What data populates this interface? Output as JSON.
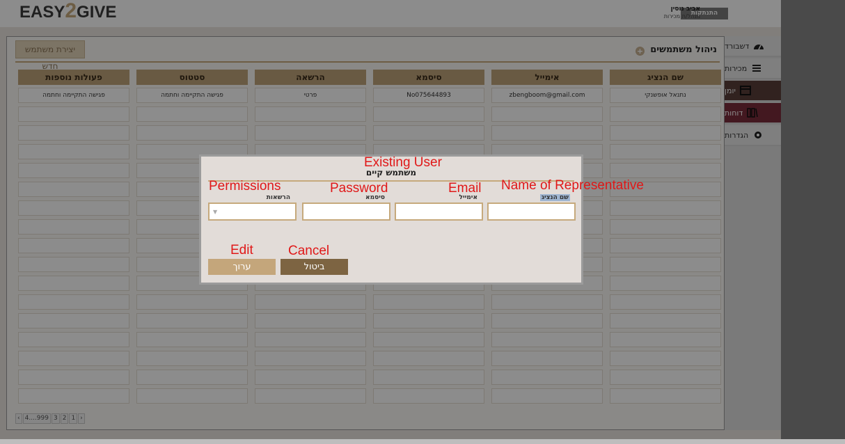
{
  "header": {
    "logo_part1": "EASY",
    "logo_part2": "2",
    "logo_part3": "GIVE",
    "logout_label": "התנתקות",
    "user_name": "אביב נוסין",
    "user_role": "מנהל/ת מכירות"
  },
  "sidebar": {
    "items": [
      {
        "label": "דשבורד",
        "icon": "dashboard-icon"
      },
      {
        "label": "מכירות",
        "icon": "sales-icon"
      },
      {
        "label": "יומן",
        "icon": "calendar-icon"
      },
      {
        "label": "דוחות",
        "icon": "reports-icon"
      },
      {
        "label": "הגדרות",
        "icon": "gear-icon"
      }
    ]
  },
  "main": {
    "title": "ניהול משתמשים",
    "new_user_label": "יצירת משתמש חדש",
    "columns": [
      "שם הנציג",
      "אימייל",
      "סיסמא",
      "הרשאה",
      "סטטוס",
      "פעולות נוספות"
    ],
    "rows": [
      [
        "נתנאל אופשנקי",
        "zbengboom@gmail.com",
        "No075644893",
        "פרטי",
        "פגישה התקיימה וחתמה",
        "פגישה התקיימה וחתמה"
      ]
    ],
    "pager": [
      "1",
      "2",
      "3",
      "4....999"
    ]
  },
  "modal": {
    "title": "משתמש קיים",
    "labels": {
      "name": "שם הנציג",
      "email": "אימייל",
      "password": "סיסמא",
      "permissions": "הרשאות"
    },
    "values": {
      "name": "",
      "email": "",
      "password": "",
      "permissions": ""
    },
    "edit_label": "ערוך",
    "cancel_label": "ביטול"
  },
  "annotations": {
    "existing_user": "Existing User",
    "permissions": "Permissions",
    "password": "Password",
    "email": "Email",
    "name": "Name of Representative",
    "edit": "Edit",
    "cancel": "Cancel"
  }
}
